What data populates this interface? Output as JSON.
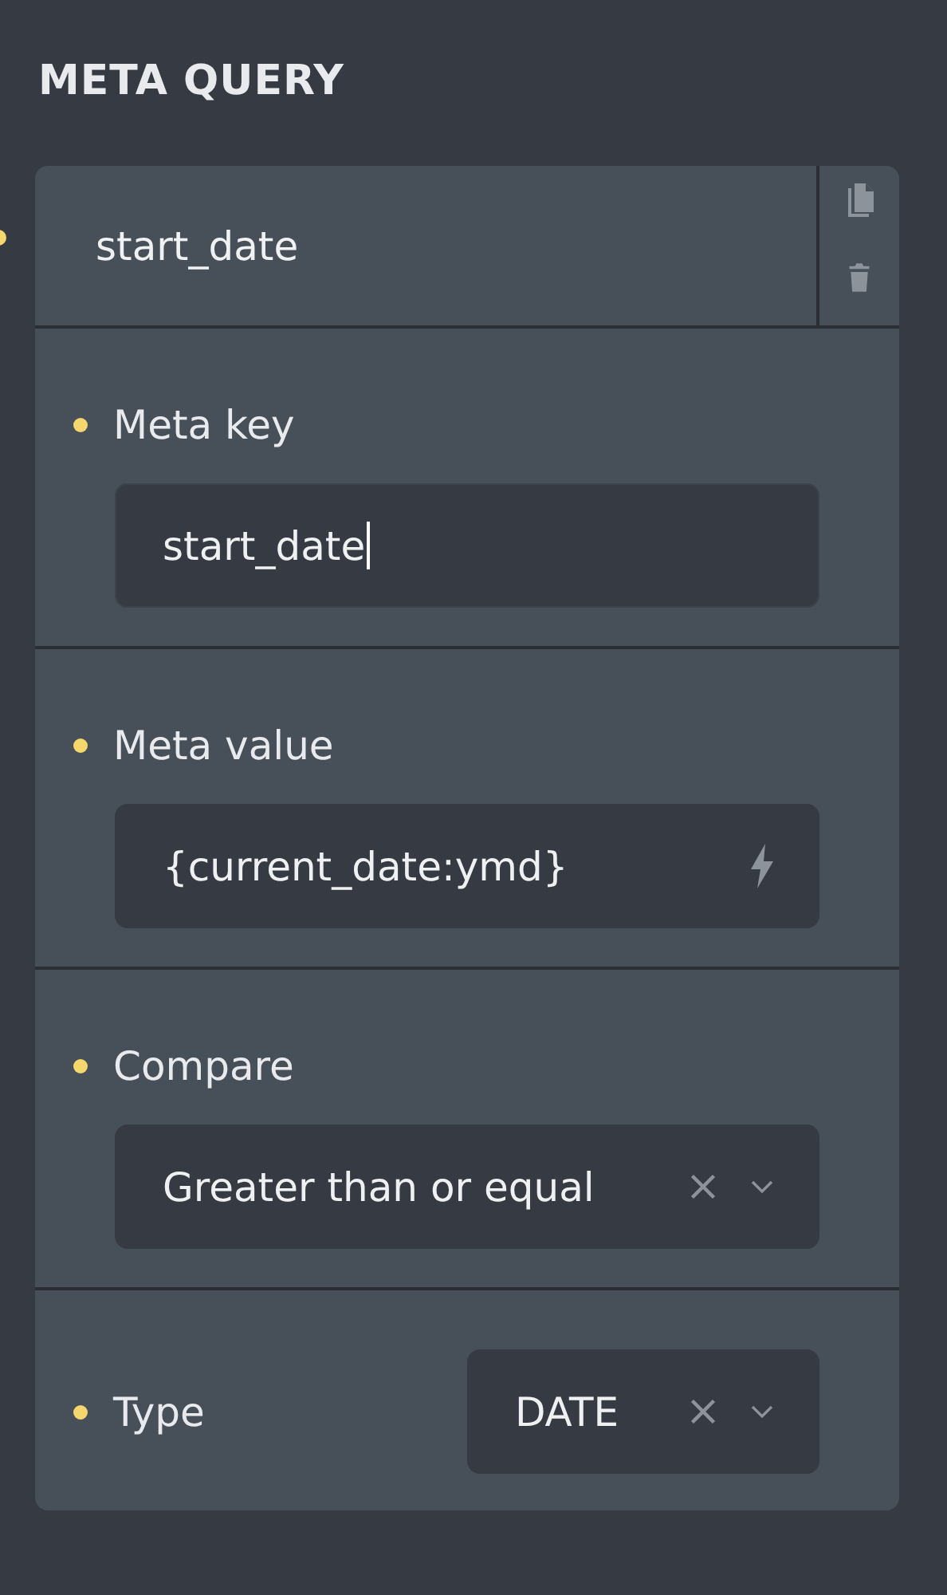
{
  "title": "META QUERY",
  "query": {
    "label": "start_date",
    "fields": [
      {
        "kind": "text",
        "label": "Meta key",
        "value": "start_date",
        "focused": true
      },
      {
        "kind": "dynamic",
        "label": "Meta value",
        "value": "{current_date:ymd}"
      },
      {
        "kind": "select",
        "label": "Compare",
        "value": "Greater than or equal"
      },
      {
        "kind": "inline-select",
        "label": "Type",
        "value": "DATE"
      }
    ]
  }
}
